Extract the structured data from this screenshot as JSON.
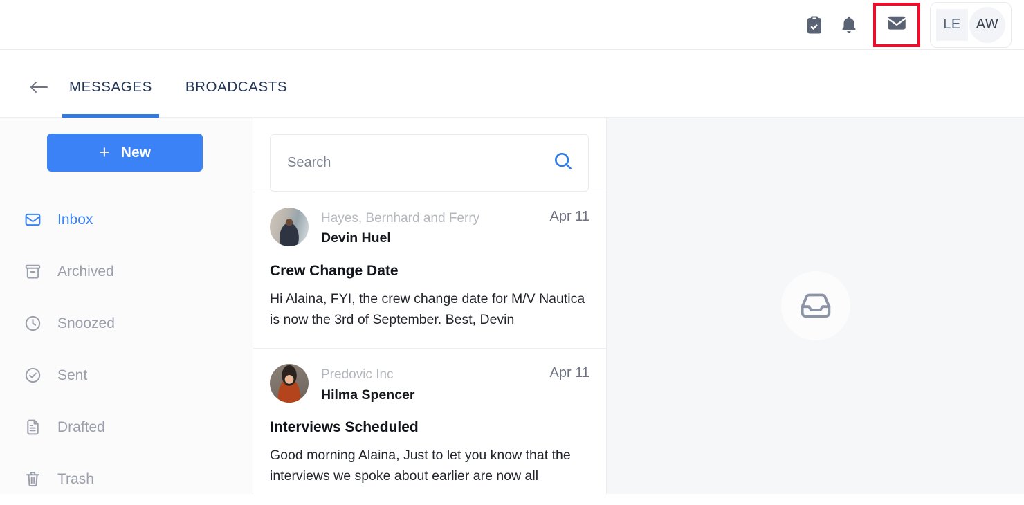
{
  "header": {
    "icons": [
      {
        "name": "clipboard-check-icon",
        "label": "Tasks"
      },
      {
        "name": "bell-icon",
        "label": "Notifications"
      },
      {
        "name": "mail-icon",
        "label": "Messages"
      }
    ],
    "highlight_color": "#e8112d",
    "avatars": {
      "square_initials": "LE",
      "circle_initials": "AW"
    }
  },
  "tabbar": {
    "back_label": "Back",
    "tabs": [
      {
        "label": "MESSAGES",
        "active": true
      },
      {
        "label": "BROADCASTS",
        "active": false
      }
    ],
    "active_color": "#2f7ae5"
  },
  "sidebar": {
    "new_button": {
      "label": "New",
      "plus": "+",
      "color": "#3b82f6"
    },
    "items": [
      {
        "label": "Inbox",
        "icon": "inbox-icon",
        "active": true
      },
      {
        "label": "Archived",
        "icon": "archive-icon",
        "active": false
      },
      {
        "label": "Snoozed",
        "icon": "clock-icon",
        "active": false
      },
      {
        "label": "Sent",
        "icon": "check-circle-icon",
        "active": false
      },
      {
        "label": "Drafted",
        "icon": "document-icon",
        "active": false
      },
      {
        "label": "Trash",
        "icon": "trash-icon",
        "active": false
      }
    ]
  },
  "search": {
    "placeholder": "Search",
    "value": "",
    "icon": "search-icon"
  },
  "messages": [
    {
      "company": "Hayes, Bernhard and Ferry",
      "person": "Devin Huel",
      "date": "Apr 11",
      "subject": "Crew Change Date",
      "preview": "Hi Alaina, FYI, the crew change date for M/V Nautica is now the 3rd of September. Best, Devin",
      "avatar": "photo-a"
    },
    {
      "company": "Predovic Inc",
      "person": "Hilma Spencer",
      "date": "Apr 11",
      "subject": "Interviews Scheduled",
      "preview": "Good morning Alaina, Just to let you know that the interviews we spoke about earlier are now all",
      "avatar": "photo-b"
    }
  ],
  "detail": {
    "empty_icon": "inbox-tray-icon"
  }
}
